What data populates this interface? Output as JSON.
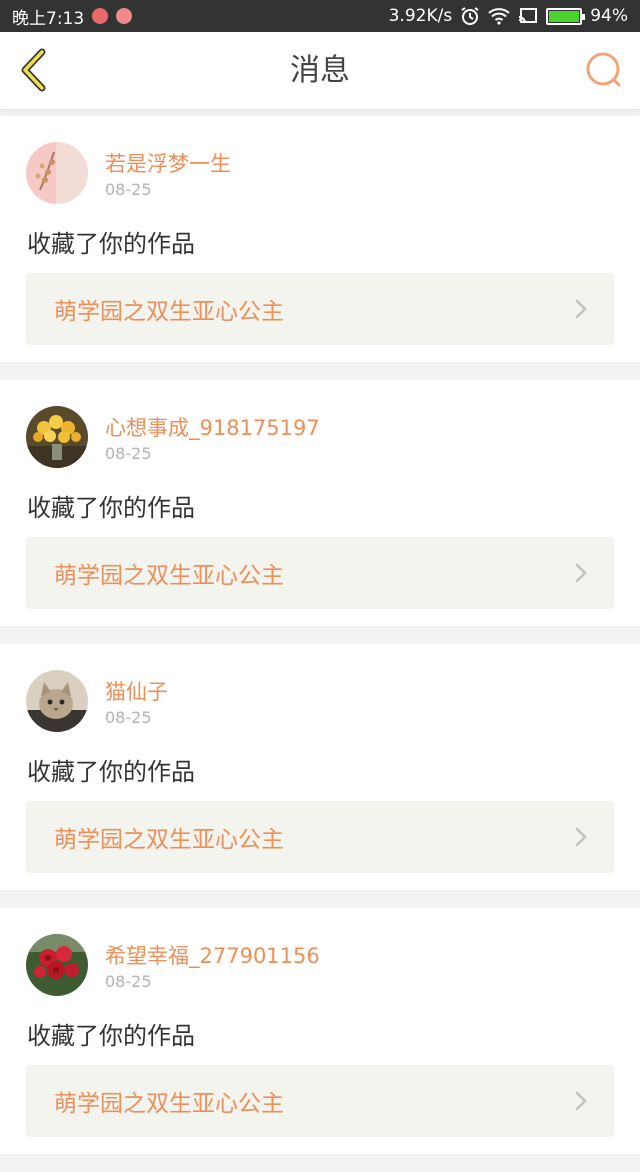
{
  "status_bar": {
    "time": "晚上7:13",
    "speed": "3.92K/s",
    "battery": "94%",
    "battery_level": 0.94
  },
  "header": {
    "title": "消息",
    "back_icon": "chevron-left-icon",
    "search_icon": "search-icon",
    "accent_color": "#ec8f58"
  },
  "messages": [
    {
      "username": "若是浮梦一生",
      "date": "08-25",
      "action": "收藏了你的作品",
      "work_title": "萌学园之双生亚心公主",
      "avatar": "pink-flower-avatar"
    },
    {
      "username": "心想事成_918175197",
      "date": "08-25",
      "action": "收藏了你的作品",
      "work_title": "萌学园之双生亚心公主",
      "avatar": "yellow-flowers-avatar"
    },
    {
      "username": "猫仙子",
      "date": "08-25",
      "action": "收藏了你的作品",
      "work_title": "萌学园之双生亚心公主",
      "avatar": "cat-avatar"
    },
    {
      "username": "希望幸福_277901156",
      "date": "08-25",
      "action": "收藏了你的作品",
      "work_title": "萌学园之双生亚心公主",
      "avatar": "red-roses-avatar"
    }
  ]
}
